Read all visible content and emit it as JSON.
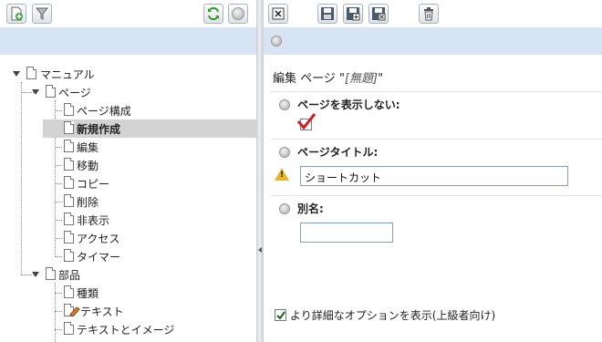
{
  "toolbar_left": {
    "buttons": [
      {
        "name": "add-page-icon"
      },
      {
        "name": "filter-icon"
      },
      {
        "name": "refresh-icon"
      },
      {
        "name": "help-icon"
      }
    ]
  },
  "toolbar_right": {
    "buttons": [
      {
        "name": "close-icon"
      },
      {
        "name": "save-icon"
      },
      {
        "name": "save-as-icon"
      },
      {
        "name": "save-close-icon"
      },
      {
        "name": "delete-icon"
      }
    ]
  },
  "tree": {
    "nodes": [
      {
        "label": "マニュアル"
      },
      {
        "label": "ページ"
      },
      {
        "label": "ページ構成"
      },
      {
        "label": "新規作成"
      },
      {
        "label": "編集"
      },
      {
        "label": "移動"
      },
      {
        "label": "コピー"
      },
      {
        "label": "削除"
      },
      {
        "label": "非表示"
      },
      {
        "label": "アクセス"
      },
      {
        "label": "タイマー"
      },
      {
        "label": "部品"
      },
      {
        "label": "種類"
      },
      {
        "label": "テキスト"
      },
      {
        "label": "テキストとイメージ"
      }
    ],
    "selected": "新規作成"
  },
  "editor": {
    "title_prefix": "編集 ページ \"",
    "title_name": "[無題]",
    "title_suffix": "\"",
    "hide_page": {
      "label": "ページを表示しない:",
      "checked": true
    },
    "page_title": {
      "label": "ページタイトル:",
      "value": "ショートカット"
    },
    "alias": {
      "label": "別名:",
      "value": ""
    },
    "advanced_options": {
      "label": "より詳細なオプションを表示(上級者向け)",
      "checked": true
    }
  }
}
